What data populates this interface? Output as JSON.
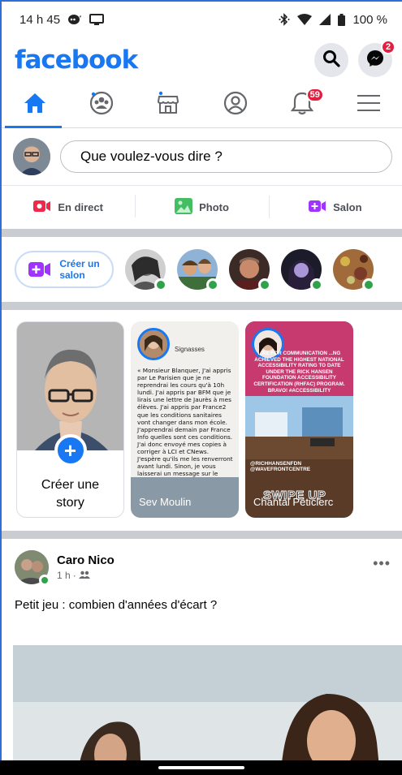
{
  "status_bar": {
    "time": "14 h 45",
    "battery": "100 %"
  },
  "header": {
    "logo": "facebook",
    "messenger_badge": "2"
  },
  "tabs": {
    "notifications_badge": "59"
  },
  "composer": {
    "placeholder": "Que voulez-vous dire ?"
  },
  "actions": [
    {
      "label": "En direct",
      "color": "#f02849"
    },
    {
      "label": "Photo",
      "color": "#45bd62"
    },
    {
      "label": "Salon",
      "color": "#a033ff"
    }
  ],
  "rooms": {
    "create_label_line1": "Créer un",
    "create_label_line2": "salon"
  },
  "stories": {
    "create_label_line1": "Créer une",
    "create_label_line2": "story",
    "story2": {
      "name": "Sev Moulin",
      "header": "Signasses",
      "text": "« Monsieur Blanquer, J'ai appris par Le Parisien que je ne reprendrai les cours qu'à 10h lundi. J'ai appris par BFM que je lirais une lettre de Jaurès à mes élèves. J'ai appris par France2 que les conditions sanitaires vont changer dans mon école. J'apprendrai demain par France Info quelles sont ces conditions. J'ai donc envoyé mes copies à corriger à LCI et CNews. J'espère qu'ils me les renverront avant lundi. Sinon, je vous laisserai un message sur le répondeur du téléphone de France Inter... »"
    },
    "story3": {
      "name": "Chantal Peticlerc",
      "top_text": "...RE FOR COMMUNICATION ...NG ACHIEVED THE HIGHEST NATIONAL ACCESSIBILITY RATING TO DATE UNDER THE RICK HANSEN FOUNDATION ACCESSIBILITY CERTIFICATION (RHFAC) PROGRAM. BRAVO! #ACCESSIBILITY",
      "handles": "@RICHHANSENFDN @WAVEFRONTCENTRE",
      "swipe": "SWIPE UP"
    }
  },
  "post": {
    "author": "Caro Nico",
    "time": "1 h",
    "text": "Petit jeu : combien d'années d'écart ?"
  },
  "colors": {
    "brand": "#1877f2",
    "badge": "#e41e3f",
    "online": "#31a24c"
  }
}
